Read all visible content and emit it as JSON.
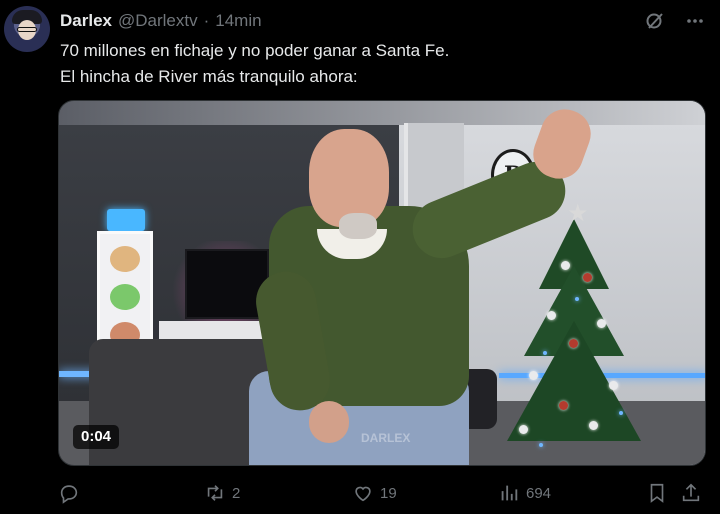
{
  "tweet": {
    "author_name": "Darlex",
    "author_handle": "@Darlextv",
    "separator": "·",
    "time": "14min",
    "text_lines": [
      "70 millones en fichaje y no poder ganar a Santa Fe.",
      "El hincha de River más tranquilo ahora:"
    ]
  },
  "media": {
    "video_duration": "0:04",
    "watermark": "DARLEX",
    "sign_text": "DX"
  },
  "actions": {
    "reply_count": "",
    "retweet_count": "2",
    "like_count": "19",
    "views_count": "694"
  },
  "icons": {
    "top": [
      "grok-icon",
      "more-icon"
    ],
    "actions": [
      "reply-icon",
      "retweet-icon",
      "like-icon",
      "views-icon",
      "bookmark-icon",
      "share-icon"
    ]
  },
  "colors": {
    "background": "#000000",
    "text": "#e7e9ea",
    "muted": "#71767b"
  }
}
